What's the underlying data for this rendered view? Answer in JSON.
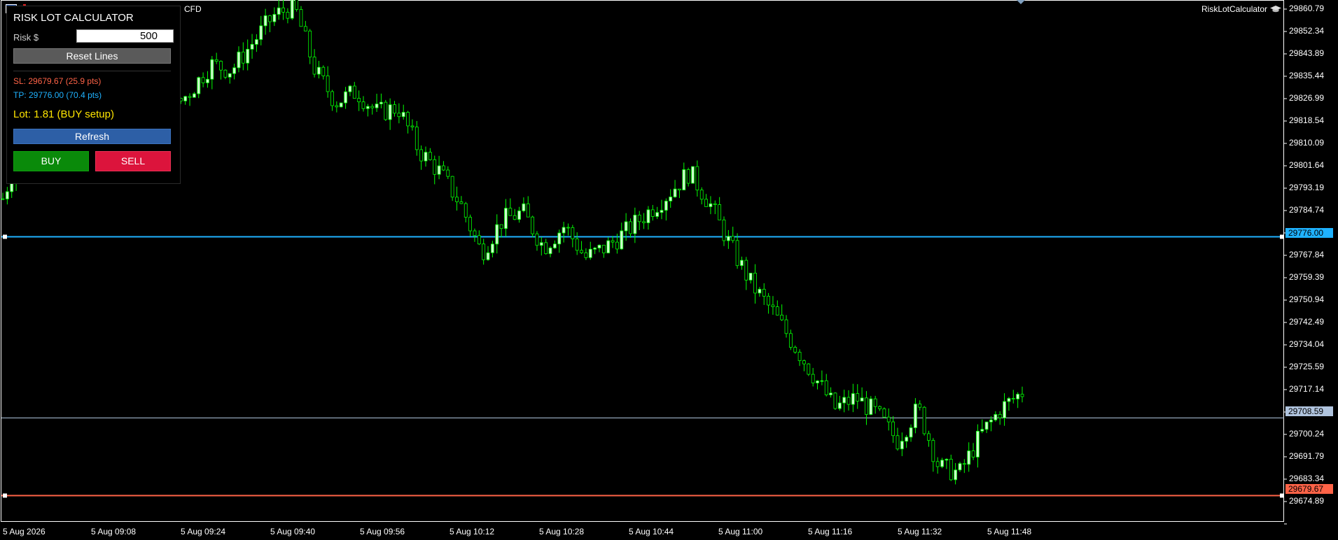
{
  "header": {
    "symbol_label": "CFD",
    "ea_name": "RiskLotCalculator",
    "icons": [
      "chart-properties-icon",
      "trade-icon",
      "graduation-cap-icon"
    ]
  },
  "panel": {
    "title": "RISK LOT CALCULATOR",
    "risk_label": "Risk $",
    "risk_value": "500",
    "reset_label": "Reset Lines",
    "sl_text": "SL: 29679.67  (25.9 pts)",
    "tp_text": "TP: 29776.00  (70.4 pts)",
    "lot_text": "Lot: 1.81  (BUY setup)",
    "refresh_label": "Refresh",
    "buy_label": "BUY",
    "sell_label": "SELL"
  },
  "price_axis": {
    "labels": [
      "29860.79",
      "29852.34",
      "29843.89",
      "29835.44",
      "29826.99",
      "29818.54",
      "29810.09",
      "29801.64",
      "29793.19",
      "29784.74",
      "29767.84",
      "29759.39",
      "29750.94",
      "29742.49",
      "29734.04",
      "29725.59",
      "29717.14",
      "29700.24",
      "29691.79",
      "29683.34",
      "29674.89"
    ]
  },
  "time_axis": {
    "labels": [
      "5 Aug 2026",
      "5 Aug 09:08",
      "5 Aug 09:24",
      "5 Aug 09:40",
      "5 Aug 09:56",
      "5 Aug 10:12",
      "5 Aug 10:28",
      "5 Aug 10:44",
      "5 Aug 11:00",
      "5 Aug 11:16",
      "5 Aug 11:32",
      "5 Aug 11:48"
    ]
  },
  "lines": {
    "tp_price": "29776.00",
    "current_price": "29708.59",
    "sl_price": "29679.67"
  },
  "colors": {
    "tp": "#1fb2ff",
    "sl": "#ff6347",
    "current": "#b0c4de",
    "candle_bull": "#ccffcc",
    "candle_bear": "#000000",
    "wick": "#00ff00"
  },
  "chart_data": {
    "type": "candlestick",
    "ylim": [
      29670,
      29864
    ],
    "close_path": [
      29790,
      29812,
      29808,
      29800,
      29822,
      29838,
      29832,
      29826,
      29822,
      29830,
      29840,
      29838,
      29848,
      29858,
      29862,
      29838,
      29826,
      29830,
      29822,
      29824,
      29808,
      29800,
      29788,
      29770,
      29782,
      29785,
      29772,
      29780,
      29768,
      29772,
      29778,
      29785,
      29792,
      29800,
      29788,
      29772,
      29758,
      29748,
      29736,
      29724,
      29712,
      29716,
      29710,
      29700,
      29712,
      29690,
      29688,
      29702,
      29712,
      29718
    ]
  }
}
